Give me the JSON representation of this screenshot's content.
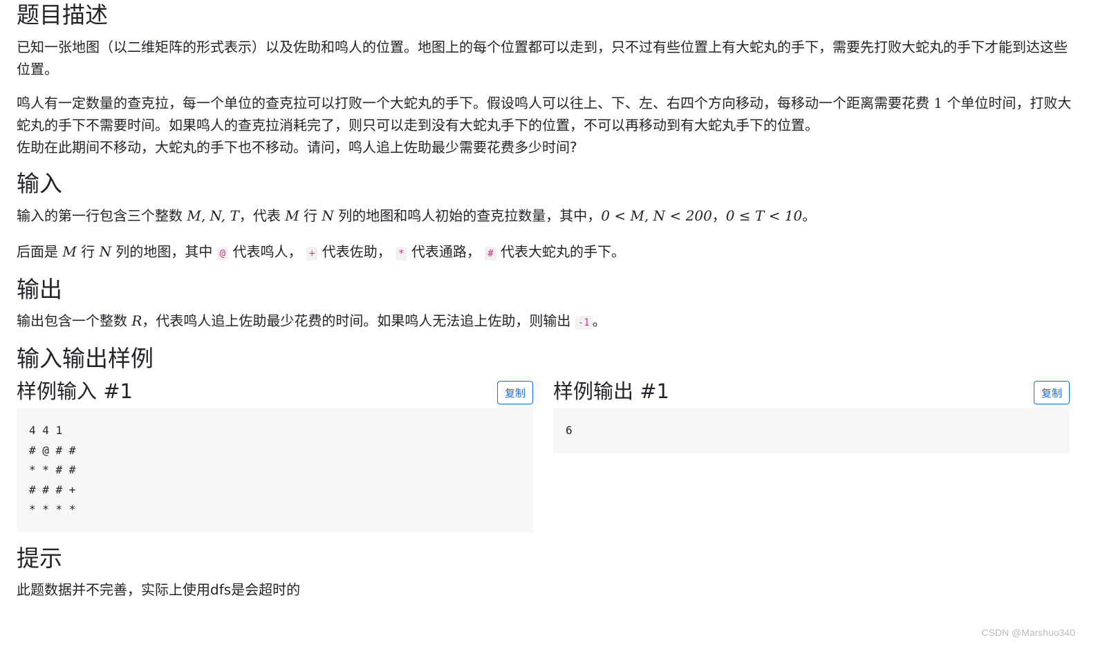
{
  "problem": {
    "title": "题目描述",
    "desc_p1": "已知一张地图（以二维矩阵的形式表示）以及佐助和鸣人的位置。地图上的每个位置都可以走到，只不过有些位置上有大蛇丸的手下，需要先打败大蛇丸的手下才能到达这些位置。",
    "desc_p2_a": "鸣人有一定数量的查克拉，每一个单位的查克拉可以打败一个大蛇丸的手下。假设鸣人可以往上、下、左、右四个方向移动，每移动一个距离需要花费",
    "desc_p2_num": "1",
    "desc_p2_b": "个单位时间，打败大蛇丸的手下不需要时间。如果鸣人的查克拉消耗完了，则只可以走到没有大蛇丸手下的位置，不可以再移动到有大蛇丸手下的位置。",
    "desc_p2_c": "佐助在此期间不移动，大蛇丸的手下也不移动。请问，鸣人追上佐助最少需要花费多少时间?"
  },
  "input": {
    "title": "输入",
    "l1_a": "输入的第一行包含三个整数",
    "l1_vars": "M, N, T",
    "l1_b": "，代表",
    "l1_m": "M",
    "l1_c": "行",
    "l1_n": "N",
    "l1_d": "列的地图和鸣人初始的查克拉数量，其中，",
    "l1_cond1": "0 < M, N < 200",
    "l1_sep": "，",
    "l1_cond2": "0 ≤ T < 10",
    "l1_end": "。",
    "l2_a": "后面是",
    "l2_m": "M",
    "l2_b": "行",
    "l2_n": "N",
    "l2_c": "列的地图，其中",
    "sym_at": "@",
    "l2_d": "代表鸣人，",
    "sym_plus": "+",
    "l2_e": "代表佐助，",
    "sym_star": "*",
    "l2_f": "代表通路，",
    "sym_hash": "#",
    "l2_g": "代表大蛇丸的手下。"
  },
  "output": {
    "title": "输出",
    "l1_a": "输出包含一个整数",
    "l1_r": "R",
    "l1_b": "，代表鸣人追上佐助最少花费的时间。如果鸣人无法追上佐助，则输出",
    "l1_code": "-1",
    "l1_end": "。"
  },
  "samples": {
    "title": "输入输出样例",
    "input_title": "样例输入 #1",
    "output_title": "样例输出 #1",
    "copy_label": "复制",
    "input_text": "4 4 1\n# @ # #\n* * # #\n# # # +\n* * * *",
    "output_text": "6"
  },
  "hint": {
    "title": "提示",
    "text": "此题数据并不完善，实际上使用dfs是会超时的"
  },
  "watermark": "CSDN @Marshuo340"
}
